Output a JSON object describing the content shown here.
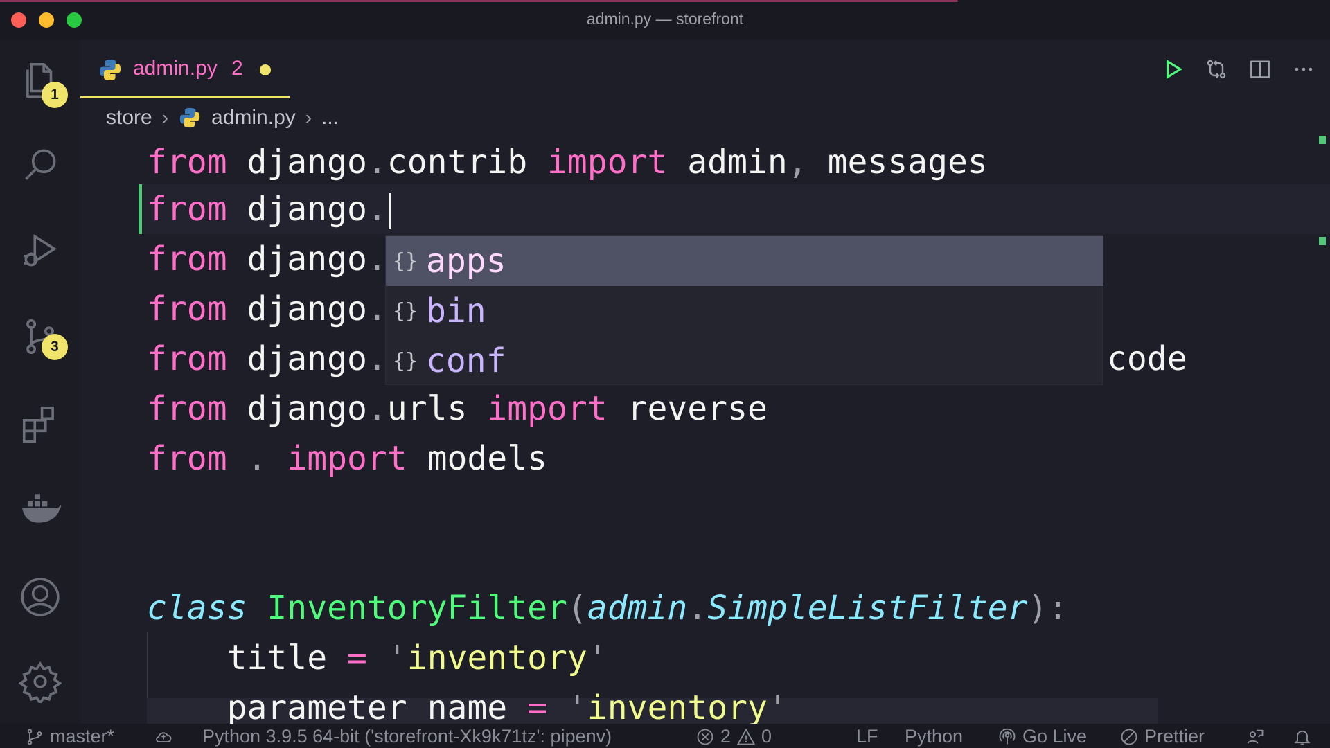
{
  "window": {
    "title": "admin.py — storefront"
  },
  "activity_bar": {
    "items": [
      {
        "name": "explorer",
        "badge": "1"
      },
      {
        "name": "search"
      },
      {
        "name": "run-debug"
      },
      {
        "name": "source-control",
        "badge": "3"
      },
      {
        "name": "extensions"
      },
      {
        "name": "docker"
      },
      {
        "name": "accounts"
      },
      {
        "name": "settings"
      }
    ]
  },
  "tab": {
    "filename": "admin.py",
    "problem_count": "2",
    "modified": true
  },
  "breadcrumb": {
    "folder": "store",
    "file": "admin.py",
    "more": "..."
  },
  "editor": {
    "lines": [
      "from django.contrib import admin, messages",
      "from django.",
      "from django.",
      "from django.",
      "from django.",
      "from django.urls import reverse",
      "from . import models",
      "",
      "",
      "class InventoryFilter(admin.SimpleListFilter):",
      "    title = 'inventory'",
      "    parameter_name = 'inventory'"
    ],
    "hidden_tail_line5": "code"
  },
  "suggest": {
    "items": [
      {
        "label": "apps",
        "kind": "module",
        "icon": "{}"
      },
      {
        "label": "bin",
        "kind": "module",
        "icon": "{}"
      },
      {
        "label": "conf",
        "kind": "module",
        "icon": "{}"
      }
    ],
    "selected": "apps"
  },
  "status_bar": {
    "branch": "master*",
    "interpreter": "Python 3.9.5 64-bit ('storefront-Xk9k71tz': pipenv)",
    "errors": "2",
    "warnings": "0",
    "eol": "LF",
    "language": "Python",
    "go_live": "Go Live",
    "prettier": "Prettier"
  },
  "colors": {
    "keyword": "#ff6ec7",
    "class_keyword": "#8be9fd",
    "class_name": "#50fa7b",
    "string": "#f1fa8c",
    "badge": "#f1e46a",
    "background": "#1d1e28"
  }
}
